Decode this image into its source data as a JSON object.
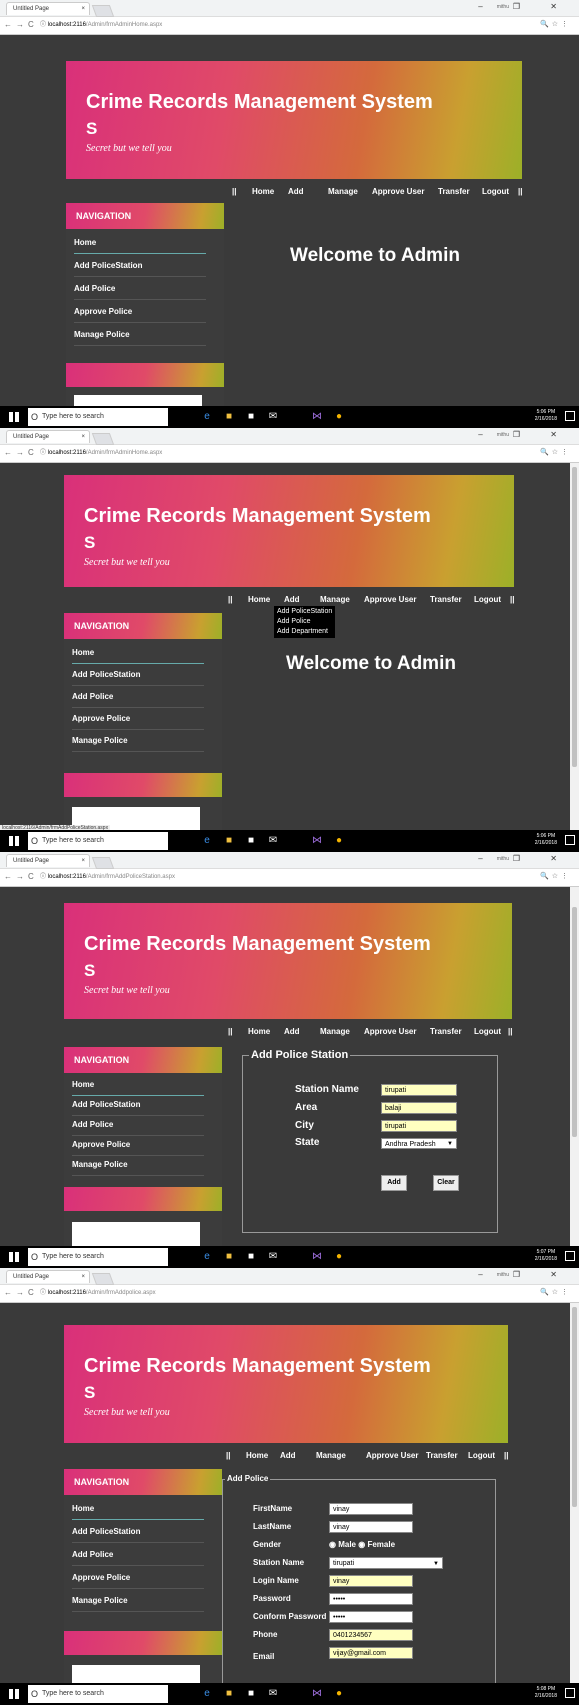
{
  "shared": {
    "tab_title": "Untitled Page",
    "tab_close": "×",
    "header_title": "Crime Records Management System",
    "header_s": "S",
    "header_tagline": "Secret but we tell you",
    "nav_heading": "NAVIGATION",
    "sidebar_items": [
      "Home",
      "Add PoliceStation",
      "Add Police",
      "Approve Police",
      "Manage Police"
    ],
    "menu": [
      "||",
      "Home",
      "Add",
      "Manage",
      "Approve User",
      "Transfer",
      "Logout",
      "||"
    ],
    "taskbar_search": "Type here to search",
    "win_controls": "–  ❐  ✕",
    "win_user": "mithu"
  },
  "shots": [
    {
      "url_host": "localhost:2116",
      "url_path": "/Admin/frmAdminHome.aspx",
      "welcome": "Welcome to Admin",
      "clock_time": "5:06 PM",
      "clock_date": "2/16/2018"
    },
    {
      "url_host": "localhost:2116",
      "url_path": "/Admin/frmAdminHome.aspx",
      "welcome": "Welcome to Admin",
      "dropdown": [
        "Add PoliceStation",
        "Add Police",
        "Add Department"
      ],
      "status_url": "localhost:2116/Admin/frmAddPoliceStation.aspx",
      "clock_time": "5:06 PM",
      "clock_date": "2/16/2018"
    },
    {
      "url_host": "localhost:2116",
      "url_path": "/Admin/frmAddPoliceStation.aspx",
      "legend": "Add Police Station",
      "fields": [
        {
          "label": "Station Name",
          "value": "tirupati"
        },
        {
          "label": "Area",
          "value": "balaji"
        },
        {
          "label": "City",
          "value": "tirupati"
        },
        {
          "label": "State",
          "value": "Andhra Pradesh"
        }
      ],
      "add_button": "Add",
      "clear_button": "Clear",
      "clock_time": "5:07 PM",
      "clock_date": "2/16/2018"
    },
    {
      "url_host": "localhost:2116",
      "url_path": "/Admin/frmAddpolice.aspx",
      "legend": "Add Police",
      "fields": [
        {
          "label": "FirstName",
          "value": "vinay"
        },
        {
          "label": "LastName",
          "value": "vinay"
        },
        {
          "label": "Gender",
          "value": ""
        },
        {
          "label": "Station Name",
          "value": "tirupati"
        },
        {
          "label": "Login Name",
          "value": "vinay"
        },
        {
          "label": "Password",
          "value": "•••••"
        },
        {
          "label": "Conform Password",
          "value": "•••••"
        },
        {
          "label": "Phone",
          "value": "0401234567"
        },
        {
          "label": "Email",
          "value": "vijay@gmail.com"
        }
      ],
      "gender_male": "Male",
      "gender_female": "Female",
      "clock_time": "5:08 PM",
      "clock_date": "2/16/2018"
    }
  ]
}
